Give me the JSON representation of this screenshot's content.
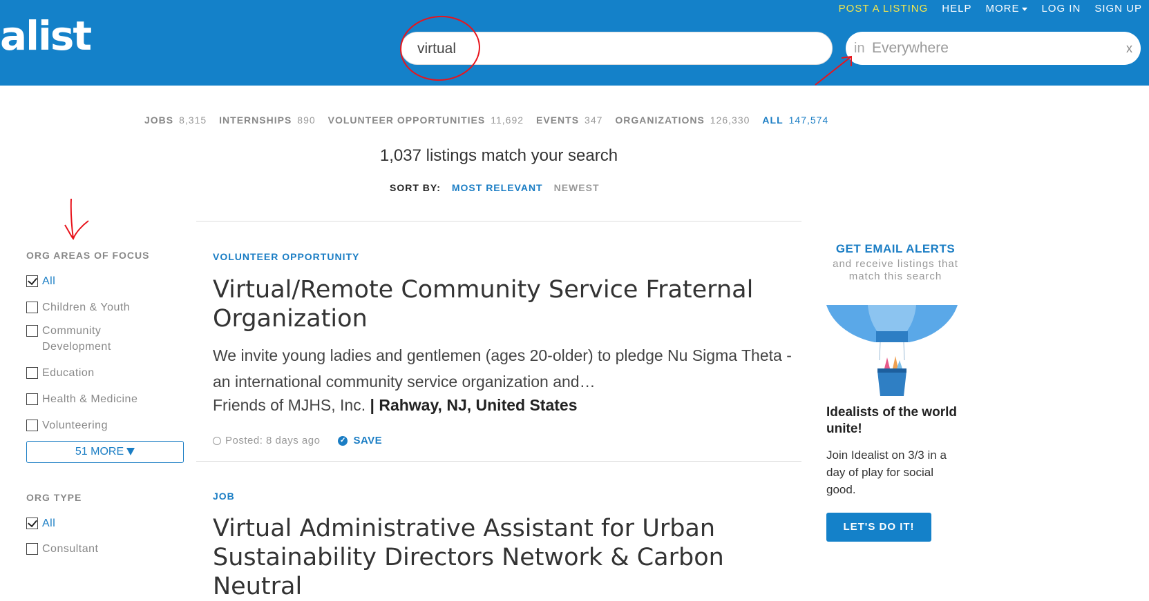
{
  "header": {
    "logo": "alist",
    "nav": {
      "post": "POST A LISTING",
      "help": "HELP",
      "more": "MORE",
      "login": "LOG IN",
      "signup": "SIGN UP"
    },
    "search_value": "virtual",
    "location_prefix": "in",
    "location_placeholder": "Everywhere",
    "clear": "x"
  },
  "counts": [
    {
      "label": "JOBS",
      "count": "8,315"
    },
    {
      "label": "INTERNSHIPS",
      "count": "890"
    },
    {
      "label": "VOLUNTEER OPPORTUNITIES",
      "count": "11,692"
    },
    {
      "label": "EVENTS",
      "count": "347"
    },
    {
      "label": "ORGANIZATIONS",
      "count": "126,330"
    },
    {
      "label": "ALL",
      "count": "147,574"
    }
  ],
  "match_text": "1,037 listings match your search",
  "sort": {
    "label": "SORT BY:",
    "relevant": "MOST RELEVANT",
    "newest": "NEWEST"
  },
  "filters": {
    "areas_title": "ORG AREAS OF FOCUS",
    "areas": [
      "All",
      "Children & Youth",
      "Community Development",
      "Education",
      "Health & Medicine",
      "Volunteering"
    ],
    "more": "51 MORE",
    "type_title": "ORG TYPE",
    "types": [
      "All",
      "Consultant"
    ]
  },
  "listings": [
    {
      "category": "VOLUNTEER OPPORTUNITY",
      "title": "Virtual/Remote Community Service Fraternal Organization",
      "description": "We invite young ladies and gentlemen (ages 20-older) to pledge Nu Sigma Theta - an international community service organization and…",
      "org": "Friends of MJHS, Inc.",
      "location": "| Rahway, NJ, United States",
      "posted": "Posted: 8 days ago",
      "save": "SAVE"
    },
    {
      "category": "JOB",
      "title": "Virtual Administrative Assistant for Urban Sustainability Directors Network & Carbon Neutral"
    }
  ],
  "rail": {
    "title": "GET EMAIL ALERTS",
    "subtitle": "and receive listings that match this search",
    "headline": "Idealists of the world unite!",
    "body": "Join Idealist on 3/3 in a day of play for social good.",
    "cta": "LET'S DO IT!"
  },
  "colors": {
    "brand_blue": "#1481c9",
    "link_blue": "#1a7dc4",
    "accent_yellow": "#f7e84a",
    "annotation_red": "#e8141c"
  }
}
